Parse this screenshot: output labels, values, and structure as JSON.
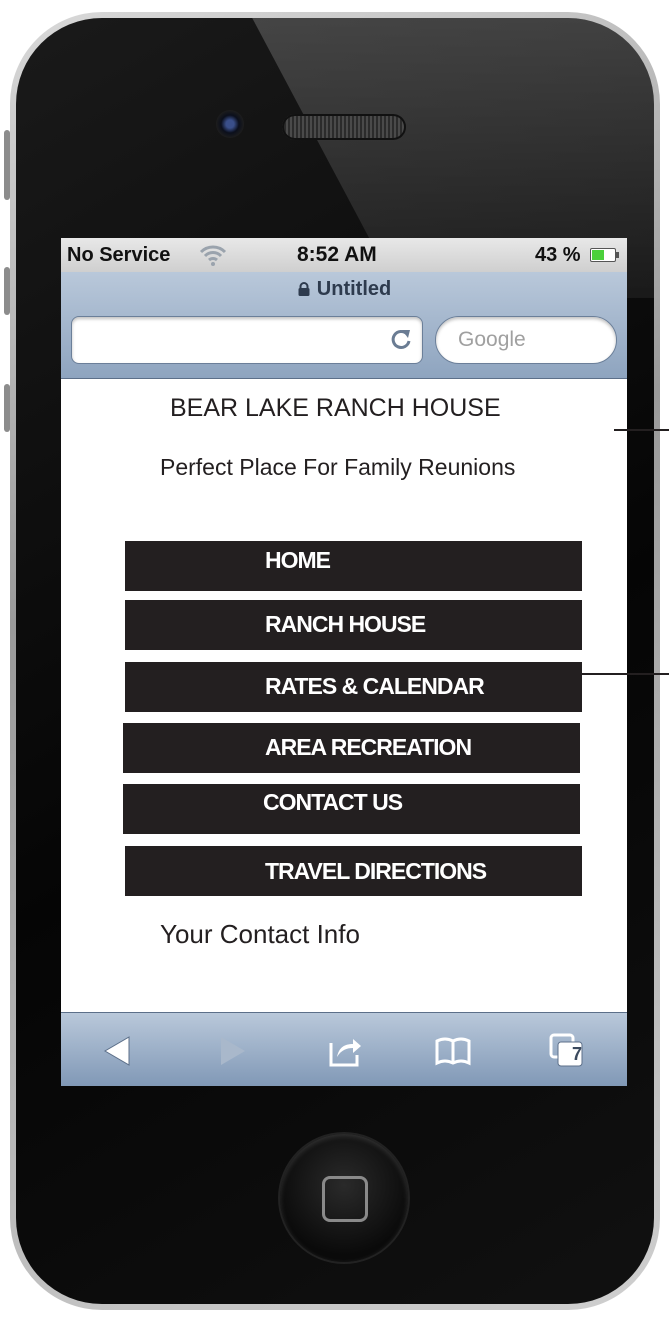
{
  "status_bar": {
    "carrier": "No Service",
    "time": "8:52 AM",
    "battery": "43 %"
  },
  "browser": {
    "page_title": "Untitled",
    "url_value": "",
    "search_placeholder": "Google",
    "tab_count": "7"
  },
  "site": {
    "title": "BEAR LAKE RANCH HOUSE",
    "tagline": "Perfect Place For  Family Reunions",
    "menu": [
      {
        "label": "HOME"
      },
      {
        "label": "RANCH HOUSE"
      },
      {
        "label": "RATES & CALENDAR"
      },
      {
        "label": "AREA RECREATION"
      },
      {
        "label": "CONTACT US"
      },
      {
        "label": "TRAVEL DIRECTIONS"
      }
    ],
    "contact": "Your Contact Info"
  },
  "colors": {
    "menu_background": "#231f20",
    "menu_text": "#ffffff",
    "browser_chrome": "#a9bad0",
    "battery_fill": "#4cd03b"
  },
  "icons": [
    "lock-icon",
    "wifi-icon",
    "battery-icon",
    "reload-icon",
    "back-icon",
    "forward-icon",
    "share-icon",
    "bookmarks-icon",
    "tabs-icon"
  ]
}
